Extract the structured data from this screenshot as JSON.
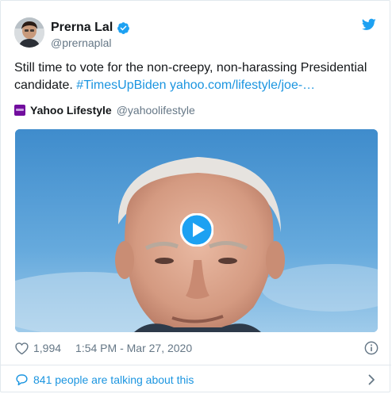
{
  "author": {
    "display_name": "Prerna Lal",
    "handle": "@prernaplal",
    "verified": true
  },
  "tweet": {
    "text_plain": "Still time to vote for the non-creepy, non-harassing Presidential candidate.",
    "hashtag": "#TimesUpBiden",
    "link_text": "yahoo.com/lifestyle/joe-…"
  },
  "quoted_source": {
    "name": "Yahoo Lifestyle",
    "handle": "@yahoolifestyle",
    "logo_icon": "yahoo-logo-icon"
  },
  "media": {
    "type": "video",
    "play_icon": "play-icon"
  },
  "meta": {
    "like_count": "1,994",
    "timestamp": "1:54 PM - Mar 27, 2020"
  },
  "footer": {
    "talking_text": "841 people are talking about this"
  },
  "colors": {
    "link_blue": "#1b95e0",
    "twitter_blue": "#1da1f2",
    "muted_gray": "#657786",
    "text_dark": "#14171a",
    "border": "#e1e8ed"
  },
  "icons": {
    "brand": "twitter-bird-icon",
    "verified": "verified-badge-icon",
    "like": "heart-icon",
    "info": "info-icon",
    "replies": "speech-bubble-icon",
    "more": "chevron-right-icon"
  }
}
